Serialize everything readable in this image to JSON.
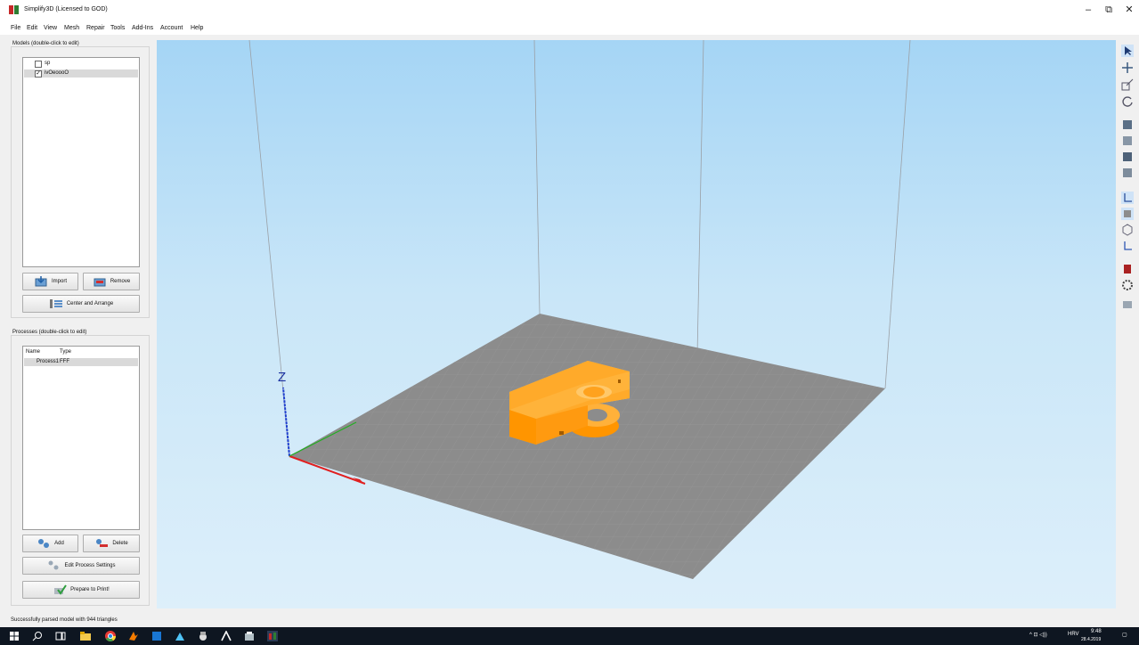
{
  "window": {
    "title": "Simplify3D (Licensed to GOD)",
    "icon": "simplify3d-logo",
    "minimize_glyph": "–",
    "restore_glyph": "⧉",
    "close_glyph": "✕"
  },
  "menu": [
    "File",
    "Edit",
    "View",
    "Mesh",
    "Repair",
    "Tools",
    "Add-Ins",
    "Account",
    "Help"
  ],
  "models": {
    "title": "Models (double-click to edit)",
    "items": [
      {
        "label": "sp",
        "checked": false
      },
      {
        "label": "ivOeoooO",
        "checked": true
      }
    ],
    "import_label": "Import",
    "remove_label": "Remove",
    "center_label": "Center and Arrange"
  },
  "processes": {
    "title": "Processes (double-click to edit)",
    "columns": [
      "Name",
      "Type"
    ],
    "rows": [
      {
        "name": "Process1",
        "type": "FFF"
      }
    ],
    "add_label": "Add",
    "delete_label": "Delete",
    "edit_label": "Edit Process Settings",
    "prepare_label": "Prepare to Print!"
  },
  "viewport": {
    "axis_label": "Z",
    "axis_colors": {
      "x": "#e02020",
      "y": "#20b020",
      "z": "#2040d0"
    },
    "bed_color": "#8c8c8c",
    "model_color": "#ff9e10"
  },
  "toolstrip": {
    "tools": [
      "select-icon",
      "move-icon",
      "scale-icon",
      "rotate-icon",
      "cube-view-icon",
      "cube-view-icon",
      "cube-view-icon",
      "cube-view-icon",
      "axis-toggle-icon",
      "cube-view-icon",
      "wireframe-icon",
      "axis-icon",
      "cut-icon",
      "settings-gear-icon",
      "preview-icon"
    ]
  },
  "status": {
    "message": "Successfully parsed model with 944 triangles"
  },
  "taskbar": {
    "icons": [
      "windows-start-icon",
      "search-icon",
      "task-view-icon",
      "file-explorer-icon",
      "chrome-icon",
      "app-icon",
      "app-icon",
      "app-icon",
      "app-icon",
      "app-icon",
      "app-icon",
      "simplify3d-taskbar-icon"
    ],
    "tray_glyphs": "^ ⊡ ◁))",
    "language": "HRV",
    "time": "9:48",
    "date": "28.4.2019",
    "notification_glyph": "▢"
  }
}
